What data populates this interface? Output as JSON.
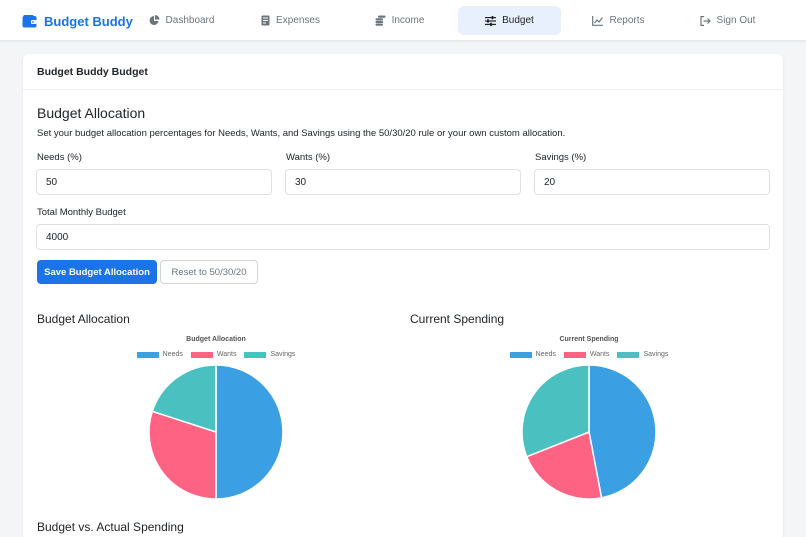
{
  "nav": {
    "brand": "Budget Buddy",
    "items": [
      {
        "key": "dashboard",
        "label": "Dashboard",
        "icon": "pie-chart-icon",
        "active": false
      },
      {
        "key": "expenses",
        "label": "Expenses",
        "icon": "receipt-icon",
        "active": false
      },
      {
        "key": "income",
        "label": "Income",
        "icon": "coins-icon",
        "active": false
      },
      {
        "key": "budget",
        "label": "Budget",
        "icon": "sliders-icon",
        "active": true
      },
      {
        "key": "reports",
        "label": "Reports",
        "icon": "line-chart-icon",
        "active": false
      },
      {
        "key": "signout",
        "label": "Sign Out",
        "icon": "sign-out-icon",
        "active": false
      }
    ]
  },
  "card": {
    "title": "Budget Buddy Budget"
  },
  "allocation": {
    "heading": "Budget Allocation",
    "description": "Set your budget allocation percentages for Needs, Wants, and Savings using the 50/30/20 rule or your own custom allocation.",
    "needs_label": "Needs (%)",
    "needs_value": "50",
    "wants_label": "Wants (%)",
    "wants_value": "30",
    "savings_label": "Savings (%)",
    "savings_value": "20",
    "total_label": "Total Monthly Budget",
    "total_value": "4000",
    "save_label": "Save Budget Allocation",
    "reset_label": "Reset to 50/30/20"
  },
  "sections": {
    "allocation_chart_heading": "Budget Allocation",
    "spending_chart_heading": "Current Spending",
    "comparison_heading": "Budget vs. Actual Spending"
  },
  "colors": {
    "needs": "#3b9fe3",
    "wants": "#ff6384",
    "savings": "#4bc0c0",
    "accent": "#1a73e8"
  },
  "chart_data": [
    {
      "type": "pie",
      "title": "Budget Allocation",
      "categories": [
        "Needs",
        "Wants",
        "Savings"
      ],
      "values": [
        50,
        30,
        20
      ],
      "legend": "top"
    },
    {
      "type": "pie",
      "title": "Current Spending",
      "categories": [
        "Needs",
        "Wants",
        "Savings"
      ],
      "values": [
        47,
        22,
        31
      ],
      "legend": "top"
    }
  ]
}
